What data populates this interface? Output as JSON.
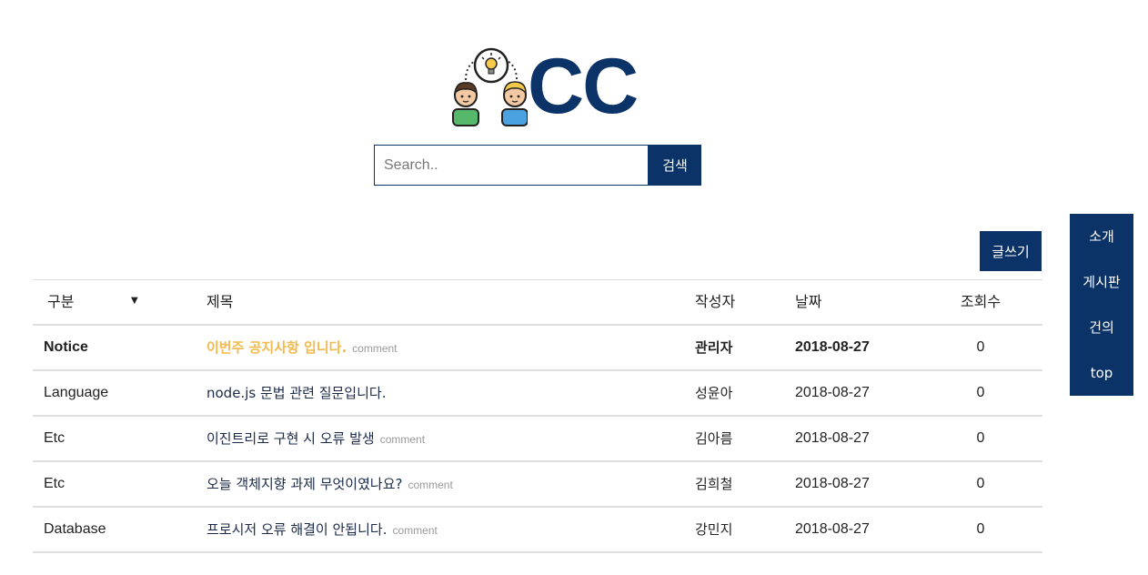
{
  "logo": {
    "text": "CC",
    "icon": "two-people-lightbulb-icon",
    "brand_color": "#0b3368"
  },
  "search": {
    "placeholder": "Search..",
    "button_label": "검색"
  },
  "write_button": "글쓰기",
  "sidenav": {
    "items": [
      "소개",
      "게시판",
      "건의",
      "top"
    ]
  },
  "table": {
    "headers": {
      "category": "구분",
      "title": "제목",
      "author": "작성자",
      "date": "날짜",
      "views": "조회수"
    },
    "rows": [
      {
        "category": "Notice",
        "title": "이번주 공지사항 입니다.",
        "comment": "comment",
        "author": "관리자",
        "date": "2018-08-27",
        "views": "0",
        "notice": true
      },
      {
        "category": "Language",
        "title": "node.js 문법 관련 질문입니다.",
        "comment": "",
        "author": "성윤아",
        "date": "2018-08-27",
        "views": "0"
      },
      {
        "category": "Etc",
        "title": "이진트리로 구현 시 오류 발생",
        "comment": "comment",
        "author": "김아름",
        "date": "2018-08-27",
        "views": "0"
      },
      {
        "category": "Etc",
        "title": "오늘 객체지향 과제 무엇이였나요?",
        "comment": "comment",
        "author": "김희철",
        "date": "2018-08-27",
        "views": "0"
      },
      {
        "category": "Database",
        "title": "프로시저 오류 해결이 안됩니다.",
        "comment": "comment",
        "author": "강민지",
        "date": "2018-08-27",
        "views": "0"
      }
    ]
  },
  "colors": {
    "accent": "#0b3368",
    "notice_title": "#f2b94d",
    "comment": "#999999"
  }
}
